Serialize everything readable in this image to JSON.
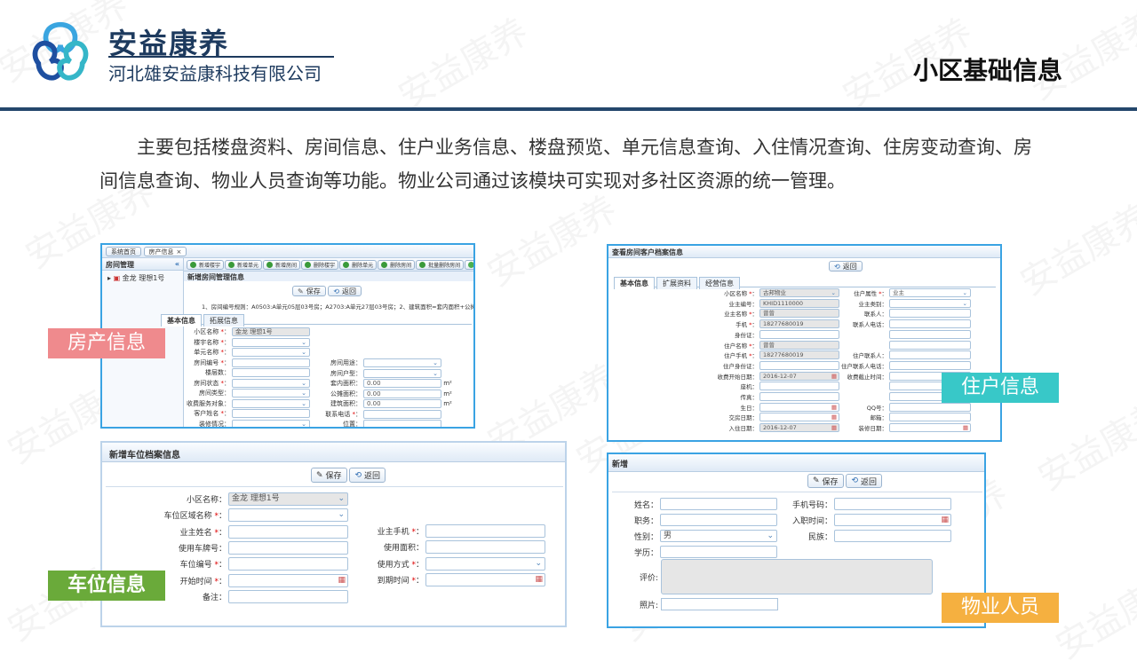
{
  "brand": {
    "name_cn": "安益康养",
    "company": "河北雄安益康科技有限公司"
  },
  "slide_title": "小区基础信息",
  "intro": "主要包括楼盘资料、房间信息、住户业务信息、楼盘预览、单元信息查询、入住情况查询、住房变动查询、房间信息查询、物业人员查询等功能。物业公司通过该模块可实现对多社区资源的统一管理。",
  "watermark": "安益康养",
  "labels": {
    "property": "房产信息",
    "resident": "住户信息",
    "parking": "车位信息",
    "staff": "物业人员"
  },
  "shot1": {
    "tabs": [
      "系统首页",
      "房产信息"
    ],
    "left_title": "房间管理",
    "tree_item": "金龙 理想1号",
    "toolbar": [
      "新增楼宇",
      "新增单元",
      "新增房间",
      "删除楼宇",
      "删除单元",
      "删除房间",
      "批量删除房间",
      "导入模板下载"
    ],
    "panel_title": "新增房间管理信息",
    "save": "保存",
    "back": "返回",
    "note": "1、房间编号规则：A0503:A单元05层03号房；A2703:A单元27层03号房；2、建筑面积=套内面积+公摊面积",
    "subtabs": [
      "基本信息",
      "拓展信息"
    ],
    "left_fields": [
      {
        "label": "小区名称",
        "req": true,
        "value": "金龙 理想1号"
      },
      {
        "label": "楼宇名称",
        "req": true
      },
      {
        "label": "单元名称",
        "req": true
      },
      {
        "label": "房间编号",
        "req": true
      },
      {
        "label": "楼层数"
      },
      {
        "label": "房间状态",
        "req": true
      },
      {
        "label": "房间类型"
      },
      {
        "label": "收费服务对象"
      },
      {
        "label": "客户姓名",
        "req": true
      },
      {
        "label": "装修情况"
      }
    ],
    "right_fields": [
      {
        "label": "房间用途"
      },
      {
        "label": "房间户型"
      },
      {
        "label": "套内面积",
        "value": "0.00",
        "unit": "m²"
      },
      {
        "label": "公摊面积",
        "value": "0.00",
        "unit": "m²"
      },
      {
        "label": "建筑面积",
        "value": "0.00",
        "unit": "m²"
      },
      {
        "label": "联系电话",
        "req": true
      },
      {
        "label": "位置"
      }
    ]
  },
  "shot2": {
    "title": "查看房间客户档案信息",
    "back": "返回",
    "subtabs": [
      "基本信息",
      "扩展资料",
      "经营信息"
    ],
    "left_fields": [
      {
        "label": "小区名称",
        "req": true,
        "value": "古邦物业"
      },
      {
        "label": "业主编号",
        "value": "KHID1110000"
      },
      {
        "label": "业主名称",
        "req": true,
        "value": "曾曾"
      },
      {
        "label": "手机",
        "req": true,
        "value": "18277680019"
      },
      {
        "label": "身份证"
      },
      {
        "label": "住户名称",
        "req": true,
        "value": "曾曾"
      },
      {
        "label": "住户手机",
        "req": true,
        "value": "18277680019"
      },
      {
        "label": "住户身份证"
      },
      {
        "label": "收费开始日期",
        "value": "2016-12-07"
      },
      {
        "label": "座机"
      },
      {
        "label": "传真"
      },
      {
        "label": "生日"
      },
      {
        "label": "交房日期"
      },
      {
        "label": "入住日期",
        "value": "2016-12-07"
      }
    ],
    "right_fields": [
      {
        "label": "住户属性",
        "req": true,
        "value": "业主"
      },
      {
        "label": "业主类别"
      },
      {
        "label": "联系人"
      },
      {
        "label": "联系人电话"
      },
      {
        "label": ""
      },
      {
        "label": ""
      },
      {
        "label": "住户联系人"
      },
      {
        "label": "住户联系人电话"
      },
      {
        "label": "收费截止时间"
      },
      {
        "label": ""
      },
      {
        "label": ""
      },
      {
        "label": "QQ号"
      },
      {
        "label": "邮箱"
      },
      {
        "label": "装修日期"
      }
    ]
  },
  "shot3": {
    "title": "新增车位档案信息",
    "save": "保存",
    "back": "返回",
    "left_fields": [
      {
        "label": "小区名称",
        "value": "金龙 理想1号"
      },
      {
        "label": "车位区域名称",
        "req": true
      },
      {
        "label": "业主姓名",
        "req": true
      },
      {
        "label": "使用车牌号"
      },
      {
        "label": "车位编号",
        "req": true
      },
      {
        "label": "开始时间",
        "req": true
      },
      {
        "label": "备注"
      }
    ],
    "right_fields": [
      {
        "label": "业主手机",
        "req": true
      },
      {
        "label": "使用面积"
      },
      {
        "label": "使用方式",
        "req": true
      },
      {
        "label": "到期时间",
        "req": true
      }
    ]
  },
  "shot4": {
    "title": "新增",
    "save": "保存",
    "back": "返回",
    "left_fields": [
      {
        "label": "姓名"
      },
      {
        "label": "职务"
      },
      {
        "label": "性别",
        "value": "男"
      },
      {
        "label": "学历"
      }
    ],
    "right_fields": [
      {
        "label": "手机号码"
      },
      {
        "label": "入职时间"
      },
      {
        "label": "民族"
      }
    ],
    "eval_label": "评价",
    "photo_label": "照片"
  }
}
